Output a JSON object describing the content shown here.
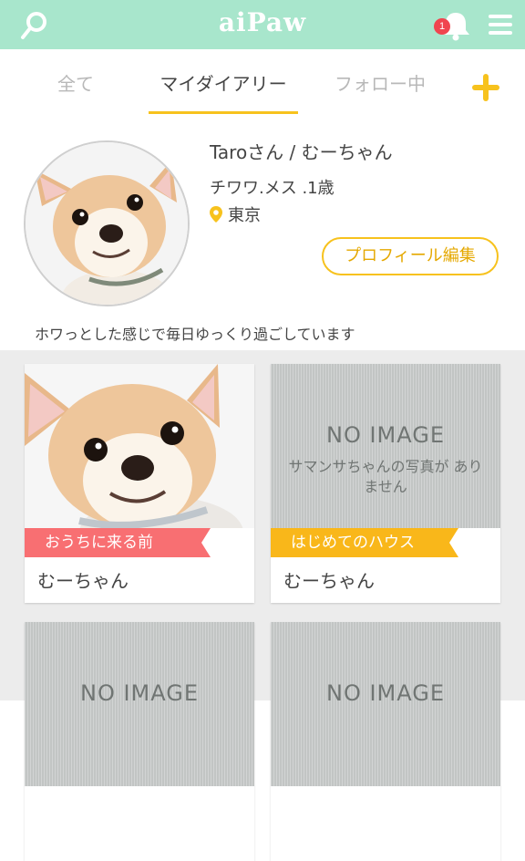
{
  "header": {
    "title": "aiPaw",
    "notification_count": "1",
    "icons": [
      "search-icon",
      "bell-icon",
      "hamburger-menu-icon"
    ],
    "bg_color": "#a8e6cc"
  },
  "tabs": [
    {
      "label": "全て",
      "active": false
    },
    {
      "label": "マイダイアリー",
      "active": true
    },
    {
      "label": "フォロー中",
      "active": false
    }
  ],
  "add_icon": "plus-icon",
  "accent_color": "#f7c21d",
  "profile": {
    "name": "Taroさん / むーちゃん",
    "breed": "チワワ.メス .1歳",
    "location": "東京",
    "edit_label": "プロフィール編集",
    "bio": "ホワっとした感じで毎日ゆっくり過ごしています"
  },
  "cards": [
    {
      "name": "むーちゃん",
      "tag": "おうちに来る前",
      "tag_color": "#f86f72",
      "has_image": true
    },
    {
      "name": "むーちゃん",
      "tag": "はじめてのハウス",
      "tag_color": "#f9b71a",
      "has_image": false,
      "no_image_title": "NO IMAGE",
      "no_image_text": "サマンサちゃんの写真が ありません"
    },
    {
      "name": "",
      "has_image": false,
      "no_image_title": "NO IMAGE"
    },
    {
      "name": "",
      "has_image": false,
      "no_image_title": "NO IMAGE"
    }
  ]
}
